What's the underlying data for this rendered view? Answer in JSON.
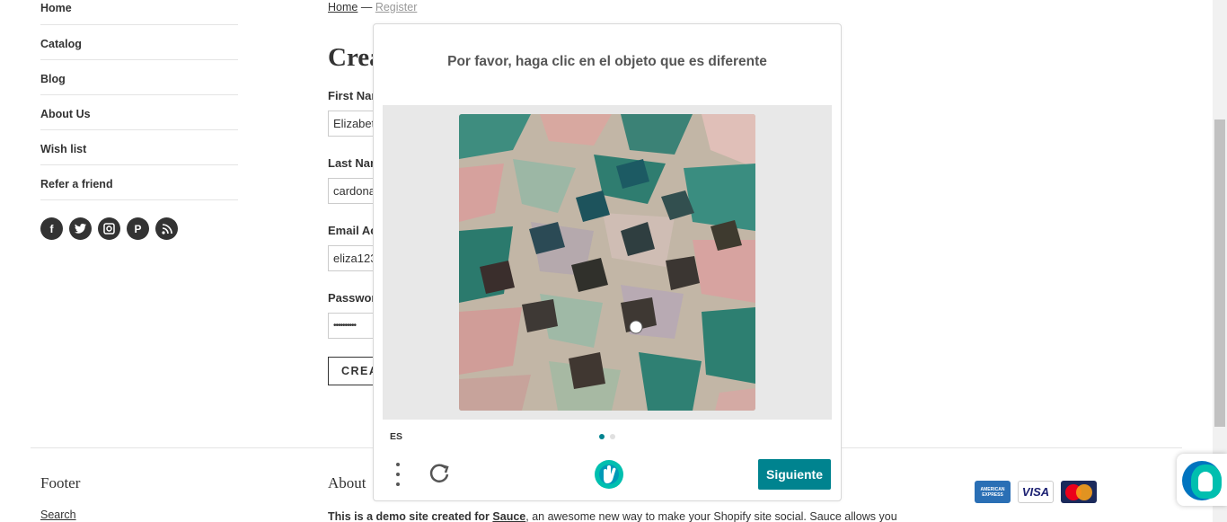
{
  "sidebar": {
    "items": [
      {
        "label": "Home"
      },
      {
        "label": "Catalog"
      },
      {
        "label": "Blog"
      },
      {
        "label": "About Us"
      },
      {
        "label": "Wish list"
      },
      {
        "label": "Refer a friend"
      }
    ],
    "social": [
      "facebook-icon",
      "twitter-icon",
      "instagram-icon",
      "pinterest-icon",
      "rss-icon"
    ]
  },
  "breadcrumb": {
    "home": "Home",
    "separator": "—",
    "current": "Register"
  },
  "form": {
    "title": "Crea",
    "first_name_label": "First Nar",
    "first_name_value": "Elizabet",
    "last_name_label": "Last Nar",
    "last_name_value": "cardona",
    "email_label": "Email Ac",
    "email_value": "eliza123",
    "password_label": "Passwor",
    "password_value": "••••••••••",
    "create_button": "CREA"
  },
  "footer": {
    "title": "Footer",
    "search_link": "Search",
    "about_title": "About",
    "about_text_prefix": "This is a demo site created for ",
    "about_text_link": "Sauce",
    "about_text_suffix": ", an awesome new way to make your Shopify site social. Sauce allows you",
    "cards": [
      "AMERICAN EXPRESS",
      "VISA",
      "MasterCard"
    ]
  },
  "captcha": {
    "prompt": "Por favor, haga clic en el objeto que es diferente",
    "language": "ES",
    "next_button": "Siguiente",
    "page_indicator": {
      "current": 1,
      "total": 2
    },
    "colors": {
      "accent": "#00838f",
      "inactive_dot": "#e0e0e0"
    }
  }
}
